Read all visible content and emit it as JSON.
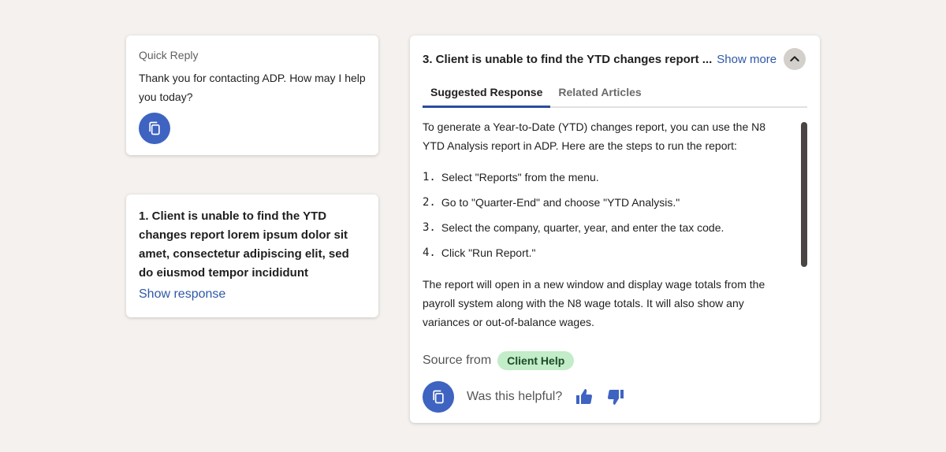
{
  "quick_reply": {
    "title": "Quick Reply",
    "text": "Thank you for contacting ADP. How may I help you today?"
  },
  "question": {
    "text": "1. Client is unable to find the YTD changes report lorem ipsum dolor sit amet, consectetur adipiscing elit, sed do eiusmod tempor incididunt",
    "link": "Show response"
  },
  "answer": {
    "title": "3. Client is unable to find the YTD changes report ...",
    "show_more": "Show more",
    "tabs": [
      "Suggested Response",
      "Related Articles"
    ],
    "intro": "To generate a Year-to-Date (YTD) changes report, you can use the N8 YTD Analysis report in ADP. Here are the steps to run the report:",
    "steps": [
      {
        "num": "1.",
        "text": "Select \"Reports\" from the menu."
      },
      {
        "num": "2.",
        "text": "Go to \"Quarter-End\" and choose \"YTD Analysis.\""
      },
      {
        "num": "3.",
        "text": "Select the company, quarter, year, and enter the tax code."
      },
      {
        "num": "4.",
        "text": "Click \"Run Report.\""
      }
    ],
    "outro": "The report will open in a new window and display wage totals from the payroll system along with the N8 wage totals. It will also show any variances or out-of-balance wages.",
    "source_label": "Source from",
    "source_badge": "Client Help",
    "helpful": "Was this helpful?"
  },
  "colors": {
    "accent": "#3e63c1",
    "link": "#2f58a8",
    "badge": "#c3ecc9"
  },
  "icons": [
    "copy-icon",
    "chevron-up-icon",
    "thumbs-up-icon",
    "thumbs-down-icon"
  ]
}
